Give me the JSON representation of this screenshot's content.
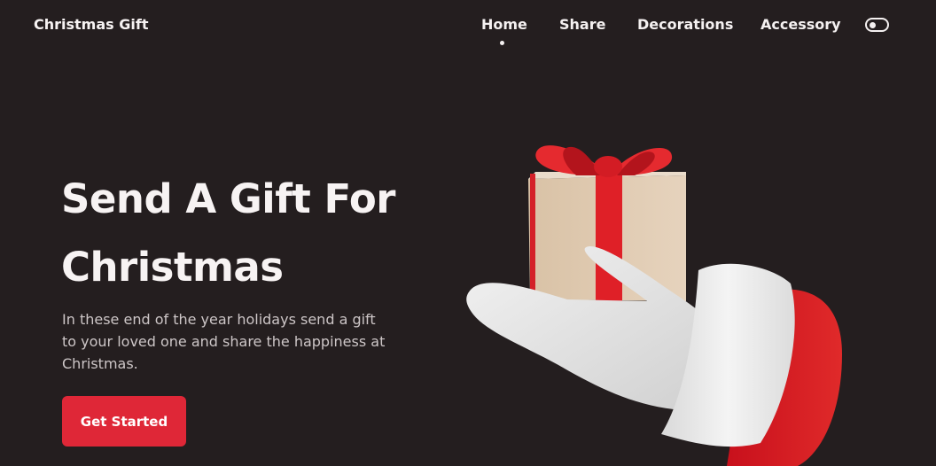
{
  "header": {
    "logo": "Christmas Gift",
    "nav": [
      {
        "label": "Home",
        "active": true
      },
      {
        "label": "Share",
        "active": false
      },
      {
        "label": "Decorations",
        "active": false
      },
      {
        "label": "Accessory",
        "active": false
      }
    ],
    "theme_toggle_icon": "toggle-icon"
  },
  "hero": {
    "title_line1": "Send A Gift For",
    "title_line2": "Christmas",
    "description": "In these end of the year holidays send a gift to your loved one and share the happiness at Christmas.",
    "cta_label": "Get Started",
    "illustration_icon": "santa-hand-gift-icon"
  },
  "colors": {
    "background": "#241e1f",
    "accent": "#df2737",
    "text": "#f7f3f3"
  }
}
